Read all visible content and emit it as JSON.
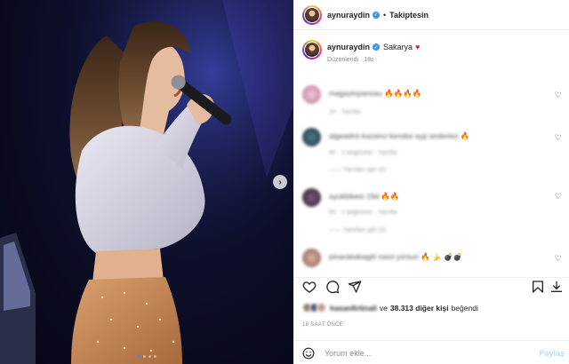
{
  "post": {
    "username": "aynuraydin",
    "follow_label": "Takiptesin",
    "separator": "•",
    "caption": "Sakarya",
    "caption_emoji": "♥",
    "edited_label": "Düzenlendi · 18s"
  },
  "comments": [
    {
      "user": "magazinpanosu",
      "emoji": "🔥🔥🔥🔥",
      "meta": "1h · Yanıtla",
      "reply": ""
    },
    {
      "user": "algeadmi kazanci kendisi ayp anderiez",
      "emoji": "🔥",
      "meta": "6h · 1 beğenme · Yanıtla",
      "reply": "——  Yanıtları gör (4)"
    },
    {
      "user": "ayukbikesi 19d",
      "emoji": "🔥🔥",
      "meta": "6h · 1 beğenme · Yanıtla",
      "reply": "——  Yanıtları gör (2)"
    },
    {
      "user": "pinarakabagiti nasıl yorsun",
      "emoji": "🔥 🍌 💣💣",
      "meta": "",
      "reply": ""
    }
  ],
  "icons": {
    "like": "heart-outline-icon",
    "comment": "comment-bubble-icon",
    "share": "paper-plane-icon",
    "save": "bookmark-icon",
    "download": "download-arrow-icon",
    "next": "chevron-right-icon",
    "emoji": "smiley-icon",
    "comment_like": "heart-outline-icon"
  },
  "likes": {
    "first_user": "hasanfirtinali",
    "connector": "ve",
    "count_text": "38.313 diğer kişi",
    "suffix": "beğendi"
  },
  "timestamp": "18 SAAT ÖNCE",
  "add_comment": {
    "placeholder": "Yorum ekle...",
    "post_label": "Paylaş"
  },
  "carousel": {
    "slide_count": 4,
    "active_index": 0
  },
  "colors": {
    "verified": "#3897f0",
    "post_button_disabled": "#b2dffc",
    "carousel_active": "#3b8cf6",
    "caption_heart": "#ed1c24"
  }
}
